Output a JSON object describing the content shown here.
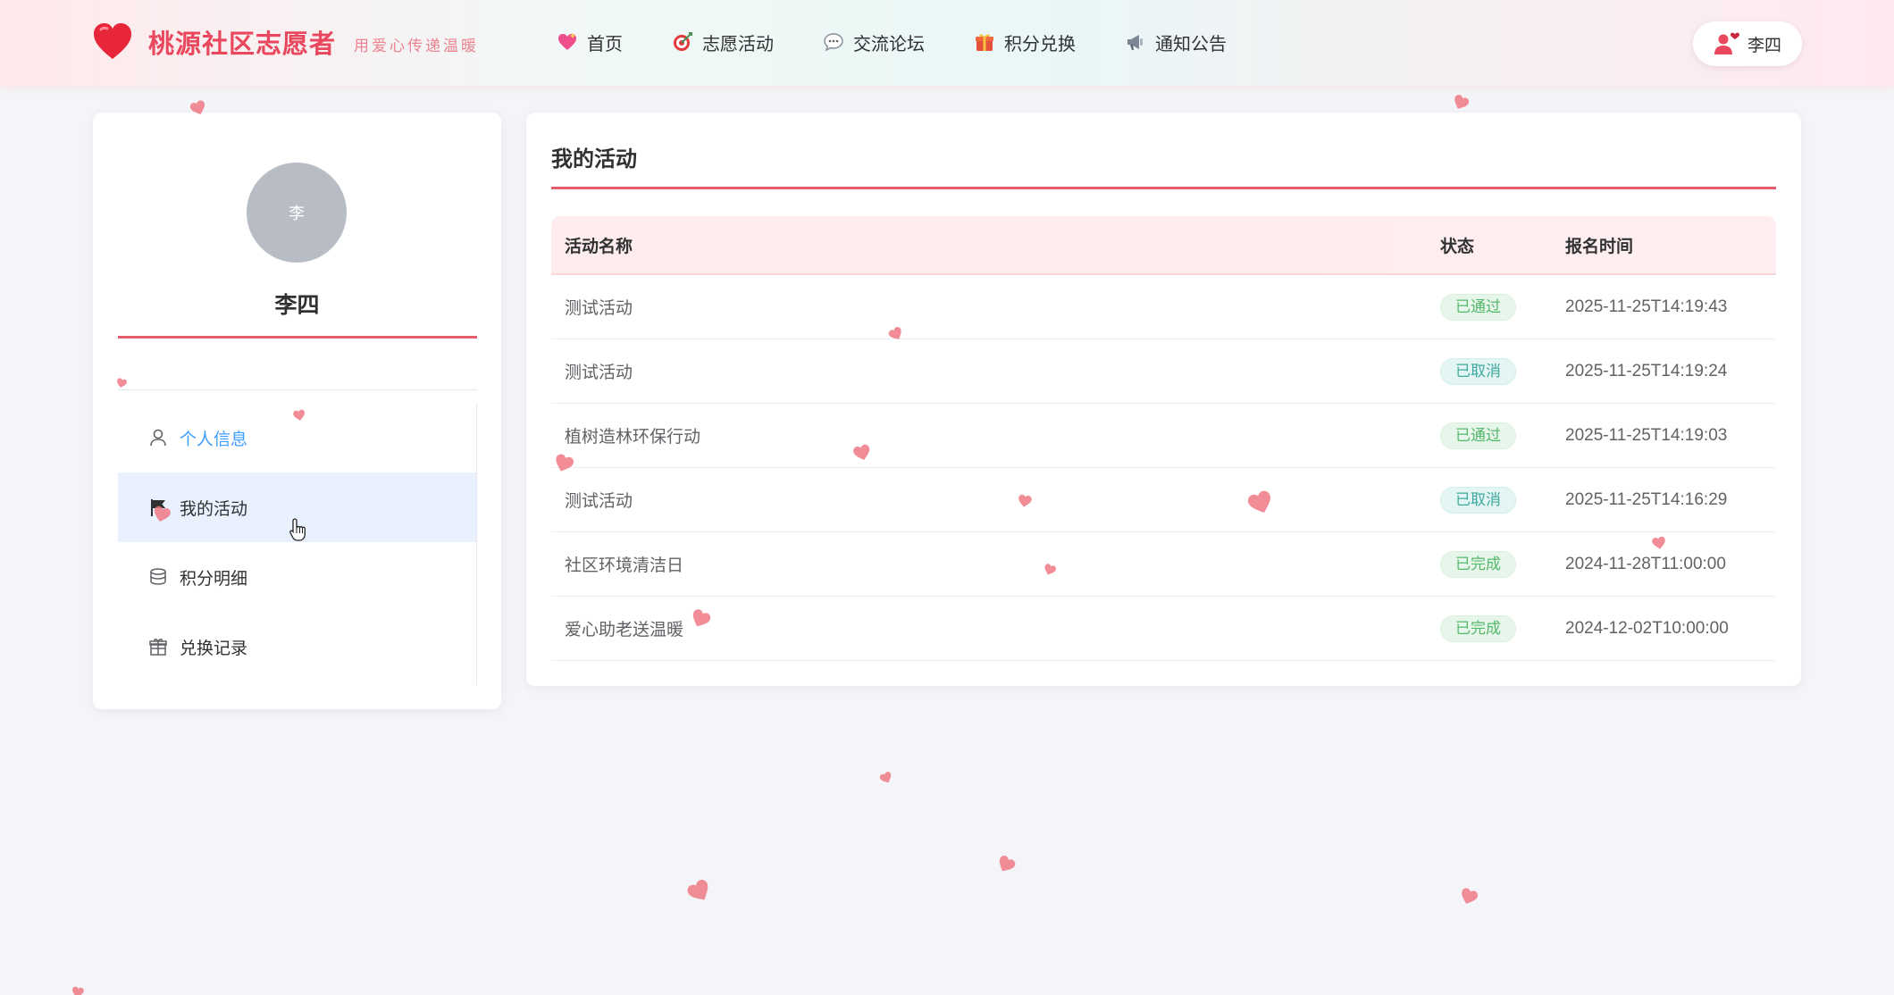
{
  "header": {
    "title": "桃源社区志愿者",
    "slogan": "用爱心传递温暖",
    "logo_icon": "heart-icon",
    "nav": [
      {
        "label": "首页",
        "icon": "sparkling-heart-icon"
      },
      {
        "label": "志愿活动",
        "icon": "target-icon"
      },
      {
        "label": "交流论坛",
        "icon": "speech-bubble-icon"
      },
      {
        "label": "积分兑换",
        "icon": "gift-icon"
      },
      {
        "label": "通知公告",
        "icon": "megaphone-icon"
      }
    ],
    "user_name": "李四",
    "user_icon": "user-heart-icon"
  },
  "sidebar": {
    "avatar_text": "李",
    "name": "李四",
    "menu": [
      {
        "label": "个人信息",
        "icon": "user-icon"
      },
      {
        "label": "我的活动",
        "icon": "flag-icon"
      },
      {
        "label": "积分明细",
        "icon": "coins-icon"
      },
      {
        "label": "兑换记录",
        "icon": "gift-box-icon"
      }
    ],
    "active_item": "我的活动"
  },
  "main": {
    "title": "我的活动",
    "columns": {
      "name": "活动名称",
      "status": "状态",
      "time": "报名时间"
    },
    "rows": [
      {
        "name": "测试活动",
        "status": "已通过",
        "status_color": "#54b86a",
        "time": "2025-11-25T14:19:43"
      },
      {
        "name": "测试活动",
        "status": "已取消",
        "status_color": "#3fa8a0",
        "time": "2025-11-25T14:19:24"
      },
      {
        "name": "植树造林环保行动",
        "status": "已通过",
        "status_color": "#54b86a",
        "time": "2025-11-25T14:19:03"
      },
      {
        "name": "测试活动",
        "status": "已取消",
        "status_color": "#3fa8a0",
        "time": "2025-11-25T14:16:29"
      },
      {
        "name": "社区环境清洁日",
        "status": "已完成",
        "status_color": "#54b86a",
        "time": "2024-11-28T11:00:00"
      },
      {
        "name": "爱心助老送温暖",
        "status": "已完成",
        "status_color": "#54b86a",
        "time": "2024-12-02T10:00:00"
      }
    ]
  },
  "colors": {
    "brand": "#e8475d",
    "accent_rule": "#e35d6a",
    "link": "#409eff",
    "active_bg": "#e8f1fd",
    "floating_heart": "#f07a86"
  }
}
